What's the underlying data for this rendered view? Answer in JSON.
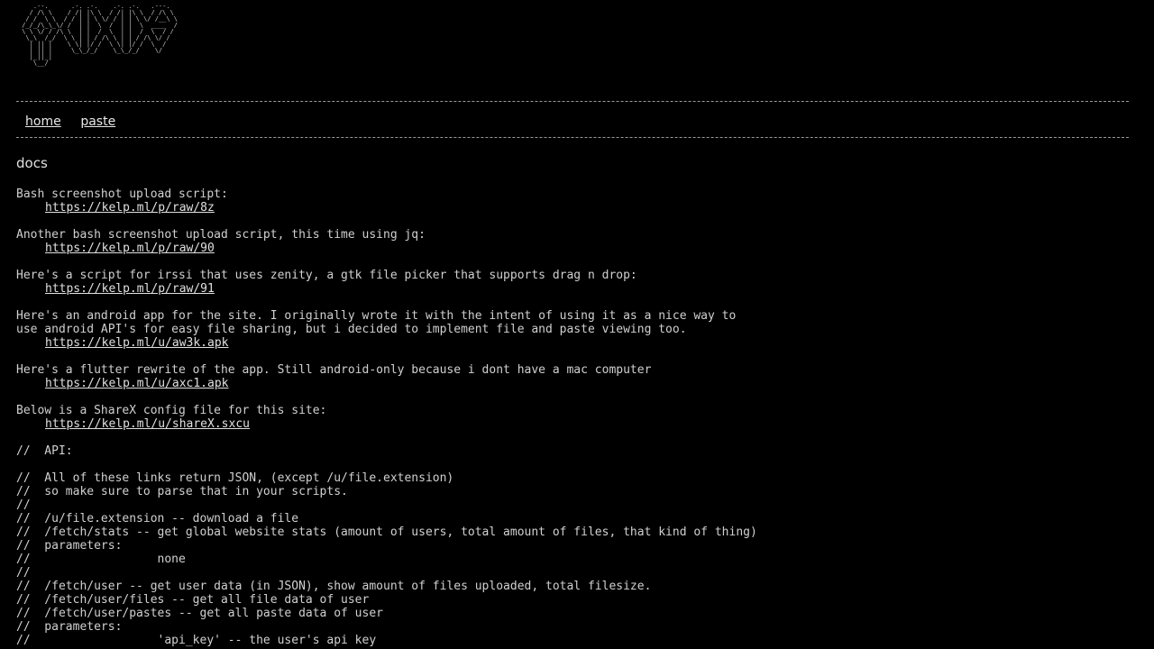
{
  "logo_art": "    .--.      .-. .-.    .-. .-.   .---.\n   / /\\ \\    / /| |\\ \\  / /| |\\ \\  / /\\ \\\n  / /  \\ \\  / / | | \\ \\/ / | | \\ \\/ /__\\ \\\n /_/_/\\_\\_\\/ /  | |  \\  /  | |  \\  ____  /\n \\ \\ \\/ / /\\ \\  | |  /  \\  | |  /  \\  / /\n  \\_\\  /_/  \\ \\ | | / /\\ \\ | | / /\\ \\/ /\n   | || |    \\ \\| |/ /  \\ \\| |/ /  \\  /\n   | || |     \\_\\_/_/    \\_\\_/_/    \\/\n   |_||_|\n    \\__/",
  "nav": {
    "home": "home",
    "paste": "paste"
  },
  "docs_title": "docs",
  "sections": {
    "bash": {
      "text": "Bash screenshot upload script:",
      "link": "https://kelp.ml/p/raw/8z"
    },
    "bash_jq": {
      "text": "Another bash screenshot upload script, this time using jq:",
      "link": "https://kelp.ml/p/raw/90"
    },
    "irssi": {
      "text": "Here's a script for irssi that uses zenity, a gtk file picker that supports drag n drop:",
      "link": "https://kelp.ml/p/raw/91"
    },
    "android_line1": "Here's an android app for the site. I originally wrote it with the intent of using it as a nice way to",
    "android_line2": "use android API's for easy file sharing, but i decided to implement file and paste viewing too.",
    "android_link": "https://kelp.ml/u/aw3k.apk",
    "flutter": {
      "text": "Here's a flutter rewrite of the app. Still android-only because i dont have a mac computer",
      "link": "https://kelp.ml/u/axc1.apk"
    },
    "sharex": {
      "text": "Below is a ShareX config file for this site:",
      "link": "https://kelp.ml/u/shareX.sxcu"
    }
  },
  "api": {
    "l1": "//  API:",
    "l2": "//  All of these links return JSON, (except /u/file.extension)",
    "l3": "//  so make sure to parse that in your scripts.",
    "l4": "//",
    "l5": "//  /u/file.extension -- download a file",
    "l6": "//  /fetch/stats -- get global website stats (amount of users, total amount of files, that kind of thing)",
    "l7": "//  parameters:",
    "l8": "//                  none",
    "l9": "//",
    "l10": "//  /fetch/user -- get user data (in JSON), show amount of files uploaded, total filesize.",
    "l11": "//  /fetch/user/files -- get all file data of user",
    "l12": "//  /fetch/user/pastes -- get all paste data of user",
    "l13": "//  parameters:",
    "l14": "//                  'api_key' -- the user's api key"
  }
}
